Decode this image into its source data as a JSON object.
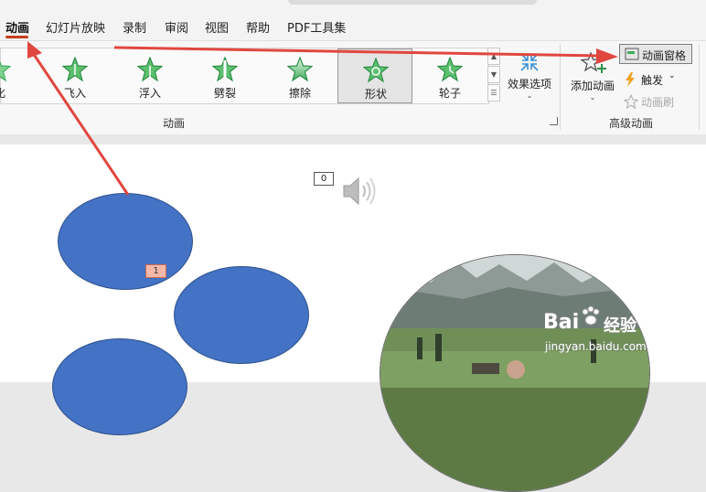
{
  "tabs": [
    {
      "label": "动画",
      "active": true
    },
    {
      "label": "幻灯片放映"
    },
    {
      "label": "录制"
    },
    {
      "label": "审阅"
    },
    {
      "label": "视图"
    },
    {
      "label": "帮助"
    },
    {
      "label": "PDF工具集"
    }
  ],
  "gallery": {
    "items": [
      {
        "label": "化",
        "icon": "fade-star-icon"
      },
      {
        "label": "飞入",
        "icon": "fly-in-star-icon"
      },
      {
        "label": "浮入",
        "icon": "float-in-star-icon"
      },
      {
        "label": "劈裂",
        "icon": "split-star-icon"
      },
      {
        "label": "擦除",
        "icon": "wipe-star-icon"
      },
      {
        "label": "形状",
        "icon": "shape-star-icon",
        "selected": true
      },
      {
        "label": "轮子",
        "icon": "wheel-star-icon"
      }
    ],
    "group_label": "动画"
  },
  "effect_options": {
    "label": "效果选项"
  },
  "advanced": {
    "add_animation": "添加动画",
    "animation_pane": "动画窗格",
    "trigger": "触发",
    "animation_painter": "动画刷",
    "group_label": "高级动画"
  },
  "slide": {
    "anim_tag": "1",
    "sound_tag": "0"
  },
  "watermark": {
    "brand": "Bai",
    "brand2": "经验",
    "url": "jingyan.baidu.com"
  },
  "colors": {
    "accent": "#c43e1c",
    "shape_fill": "#4472c4",
    "star": "#3fae5a",
    "arrow": "#e0473f"
  }
}
